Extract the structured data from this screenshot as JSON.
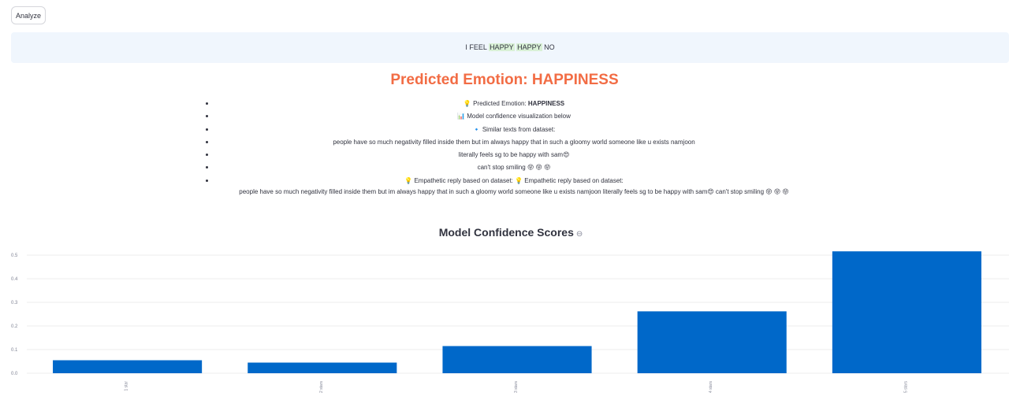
{
  "analyze_button": {
    "label": "Analyze"
  },
  "input_text": {
    "prefix": "I FEEL ",
    "hl1": "HAPPY",
    "hl2": "HAPPY",
    "suffix": " NO"
  },
  "prediction": {
    "title": "Predicted Emotion: HAPPINESS"
  },
  "info_items": {
    "item0": {
      "icon": "💡",
      "text": " Predicted Emotion: ",
      "value": "HAPPINESS"
    },
    "item1": {
      "icon": "📊",
      "text": " Model confidence visualization below"
    },
    "item2": {
      "icon": "🔹",
      "text": " Similar texts from dataset:"
    },
    "item3": {
      "text": "people have so much negativity filled inside them but im always happy that in such a gloomy world someone like u exists namjoon"
    },
    "item4": {
      "text": "literally feels sg to be happy with sam",
      "emoji": "😍"
    },
    "item5": {
      "text": "can't stop smiling ",
      "emoji": "😝 😝 😝"
    },
    "item6": {
      "icon": "💡",
      "line1": " Empathetic reply based on dataset: ",
      "icon2": "💡",
      "line1b": " Empathetic reply based on dataset:",
      "line2": "people have so much negativity filled inside them but im always happy that in such a gloomy world someone like u exists namjoon literally feels sg to be happy with sam",
      "emoji": "😍",
      "line2b": " can't stop smiling ",
      "emoji2": "😝 😝 😝"
    }
  },
  "chart_title": {
    "label": "Model Confidence Scores",
    "icon": "link-icon"
  },
  "colors": {
    "bar": "#0068c9",
    "grid": "#eeeeee",
    "title": "#f26c44"
  },
  "chart_data": {
    "type": "bar",
    "categories": [
      "1 star",
      "2 stars",
      "3 stars",
      "4 stars",
      "5 stars"
    ],
    "values": [
      0.055,
      0.045,
      0.115,
      0.262,
      0.516
    ],
    "ylim": [
      0,
      0.52
    ],
    "yticks": [
      "0.0",
      "0.1",
      "0.2",
      "0.3",
      "0.4",
      "0.5"
    ],
    "xlabel": "",
    "ylabel": "",
    "grid": true
  }
}
